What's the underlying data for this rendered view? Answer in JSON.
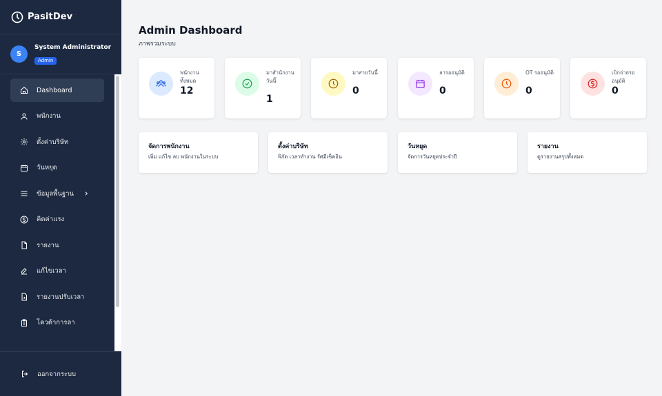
{
  "brand": {
    "name": "PasitDev",
    "icon": "clock-icon"
  },
  "user": {
    "initial": "S",
    "name": "System Administrator",
    "role": "Admin"
  },
  "nav": [
    {
      "label": "Dashboard",
      "icon": "home-icon",
      "active": true
    },
    {
      "label": "พนักงาน",
      "icon": "users-icon"
    },
    {
      "label": "ตั้งค่าบริษัท",
      "icon": "gear-icon"
    },
    {
      "label": "วันหยุด",
      "icon": "calendar-icon"
    },
    {
      "label": "ข้อมูลพื้นฐาน",
      "icon": "menu-icon",
      "has_submenu": true
    },
    {
      "label": "คิดค่าแรง",
      "icon": "dollar-icon"
    },
    {
      "label": "รายงาน",
      "icon": "document-icon"
    },
    {
      "label": "แก้ไขเวลา",
      "icon": "edit-icon"
    },
    {
      "label": "รายงานปรับเวลา",
      "icon": "document-chart-icon"
    },
    {
      "label": "โควต้าการลา",
      "icon": "clipboard-icon"
    }
  ],
  "logout": {
    "label": "ออกจากระบบ",
    "icon": "logout-icon"
  },
  "header": {
    "title": "Admin Dashboard",
    "subtitle": "ภาพรวมระบบ"
  },
  "stats": [
    {
      "label": "พนักงานทั้งหมด",
      "value": "12",
      "icon": "users-icon",
      "color": "#2563eb",
      "bg": "#dbeafe"
    },
    {
      "label": "มาสำนักงานวันนี้",
      "value": "1",
      "icon": "check-circle-icon",
      "color": "#16a34a",
      "bg": "#dcfce7"
    },
    {
      "label": "มาสายวันนี้",
      "value": "0",
      "icon": "clock-icon",
      "color": "#a16207",
      "bg": "#fef9c3"
    },
    {
      "label": "ลารออนุมัติ",
      "value": "0",
      "icon": "calendar-icon",
      "color": "#9333ea",
      "bg": "#f3e8ff"
    },
    {
      "label": "OT รออนุมัติ",
      "value": "0",
      "icon": "clock-icon",
      "color": "#ea580c",
      "bg": "#ffedd5"
    },
    {
      "label": "เบิกจ่ายรออนุมัติ",
      "value": "0",
      "icon": "dollar-icon",
      "color": "#dc2626",
      "bg": "#fee2e2"
    }
  ],
  "quick_links": [
    {
      "title": "จัดการพนักงาน",
      "desc": "เพิ่ม แก้ไข ลบ พนักงานในระบบ"
    },
    {
      "title": "ตั้งค่าบริษัท",
      "desc": "พิกัด เวลาทำงาน รัศมีเช็คอิน"
    },
    {
      "title": "วันหยุด",
      "desc": "จัดการวันหยุดประจำปี"
    },
    {
      "title": "รายงาน",
      "desc": "ดูรายงานสรุปทั้งหมด"
    }
  ]
}
